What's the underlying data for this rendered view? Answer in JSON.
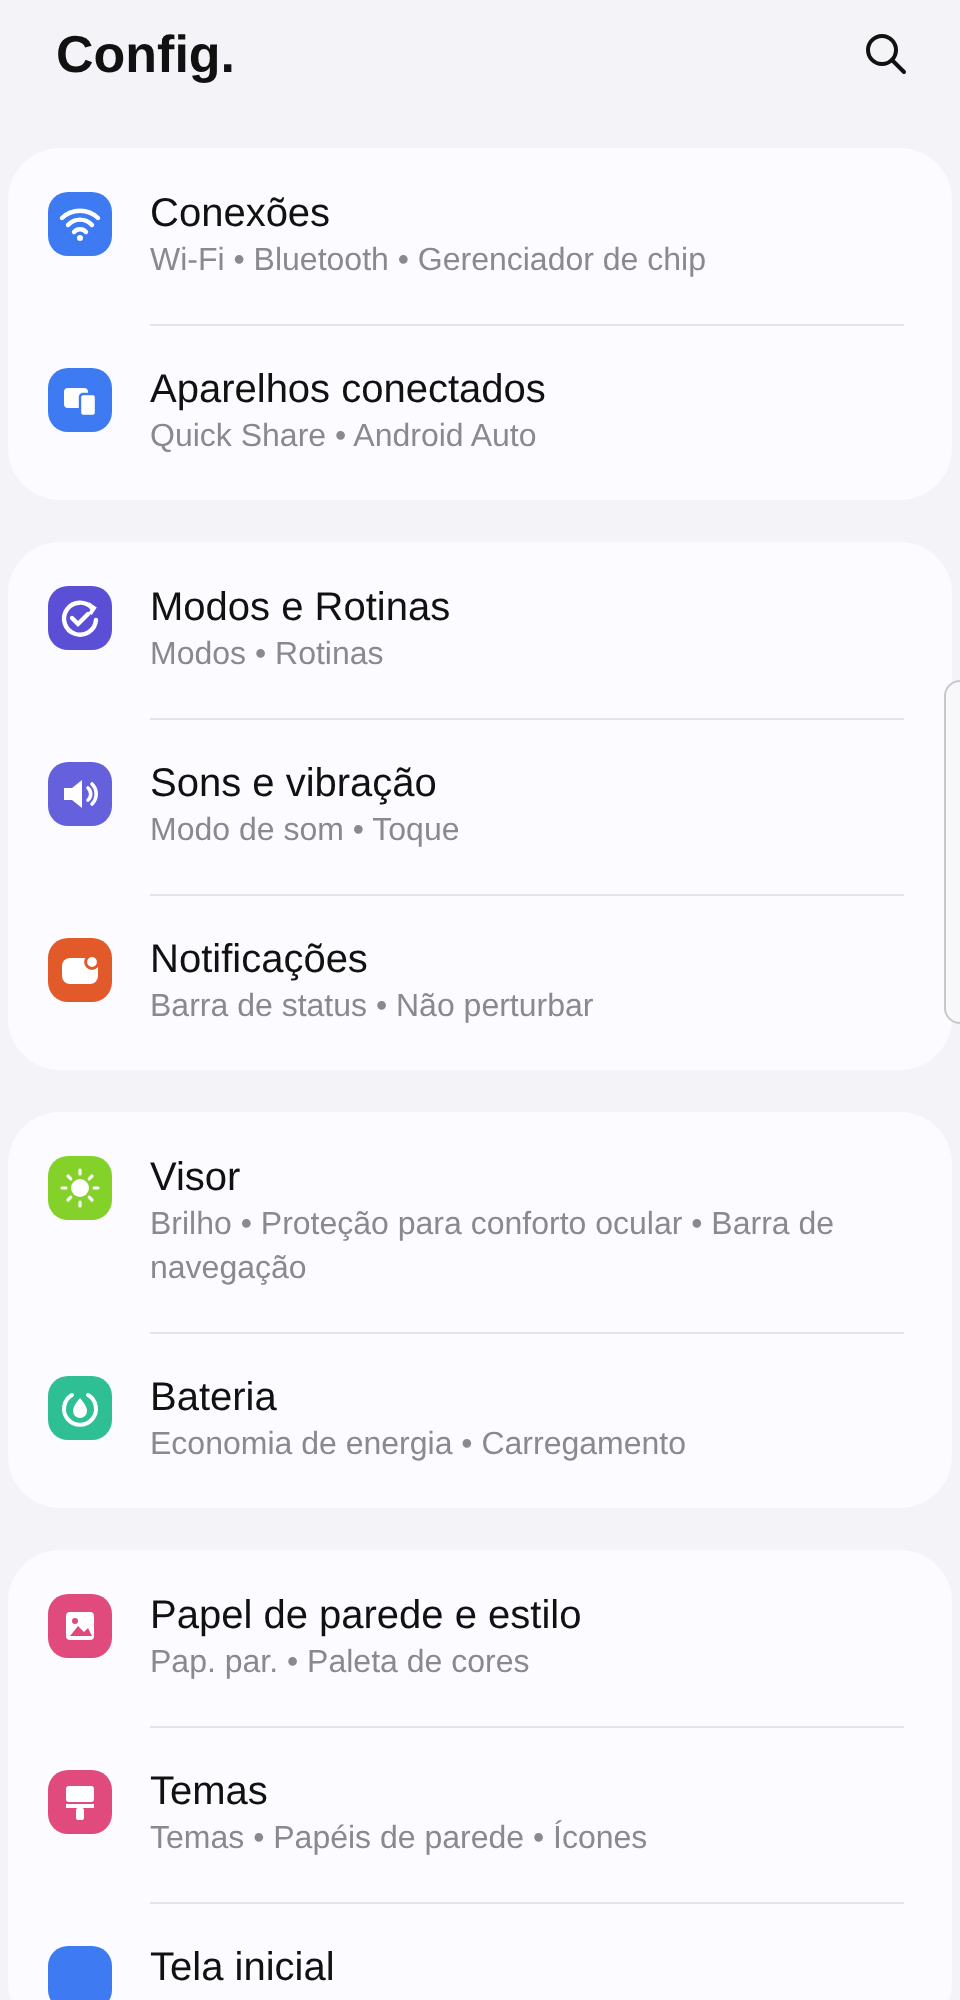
{
  "header": {
    "title": "Config."
  },
  "groups": [
    {
      "items": [
        {
          "title": "Conexões",
          "subtitle": "Wi-Fi • Bluetooth • Gerenciador de chip",
          "kind": "wifi",
          "color": "#3e7bf2"
        },
        {
          "title": "Aparelhos conectados",
          "subtitle": "Quick Share • Android Auto",
          "kind": "devices",
          "color": "#3e7bf2"
        }
      ]
    },
    {
      "items": [
        {
          "title": "Modos e Rotinas",
          "subtitle": "Modos • Rotinas",
          "kind": "routine",
          "color": "#5b4fd6"
        },
        {
          "title": "Sons e vibração",
          "subtitle": "Modo de som • Toque",
          "kind": "sound",
          "color": "#6560dc"
        },
        {
          "title": "Notificações",
          "subtitle": "Barra de status • Não perturbar",
          "kind": "notification",
          "color": "#e2592a"
        }
      ]
    },
    {
      "items": [
        {
          "title": "Visor",
          "subtitle": "Brilho • Proteção para conforto ocular • Barra de navegação",
          "kind": "sun",
          "color": "#84d12a"
        },
        {
          "title": "Bateria",
          "subtitle": "Economia de energia • Carregamento",
          "kind": "battery",
          "color": "#2ebf95"
        }
      ]
    },
    {
      "items": [
        {
          "title": "Papel de parede e estilo",
          "subtitle": "Pap. par. • Paleta de cores",
          "kind": "picture",
          "color": "#e04a7d"
        },
        {
          "title": "Temas",
          "subtitle": "Temas • Papéis de parede • Ícones",
          "kind": "brush",
          "color": "#e04a7d"
        },
        {
          "title": "Tela inicial",
          "kind": "home",
          "color": "#3e7bf2"
        }
      ]
    }
  ]
}
